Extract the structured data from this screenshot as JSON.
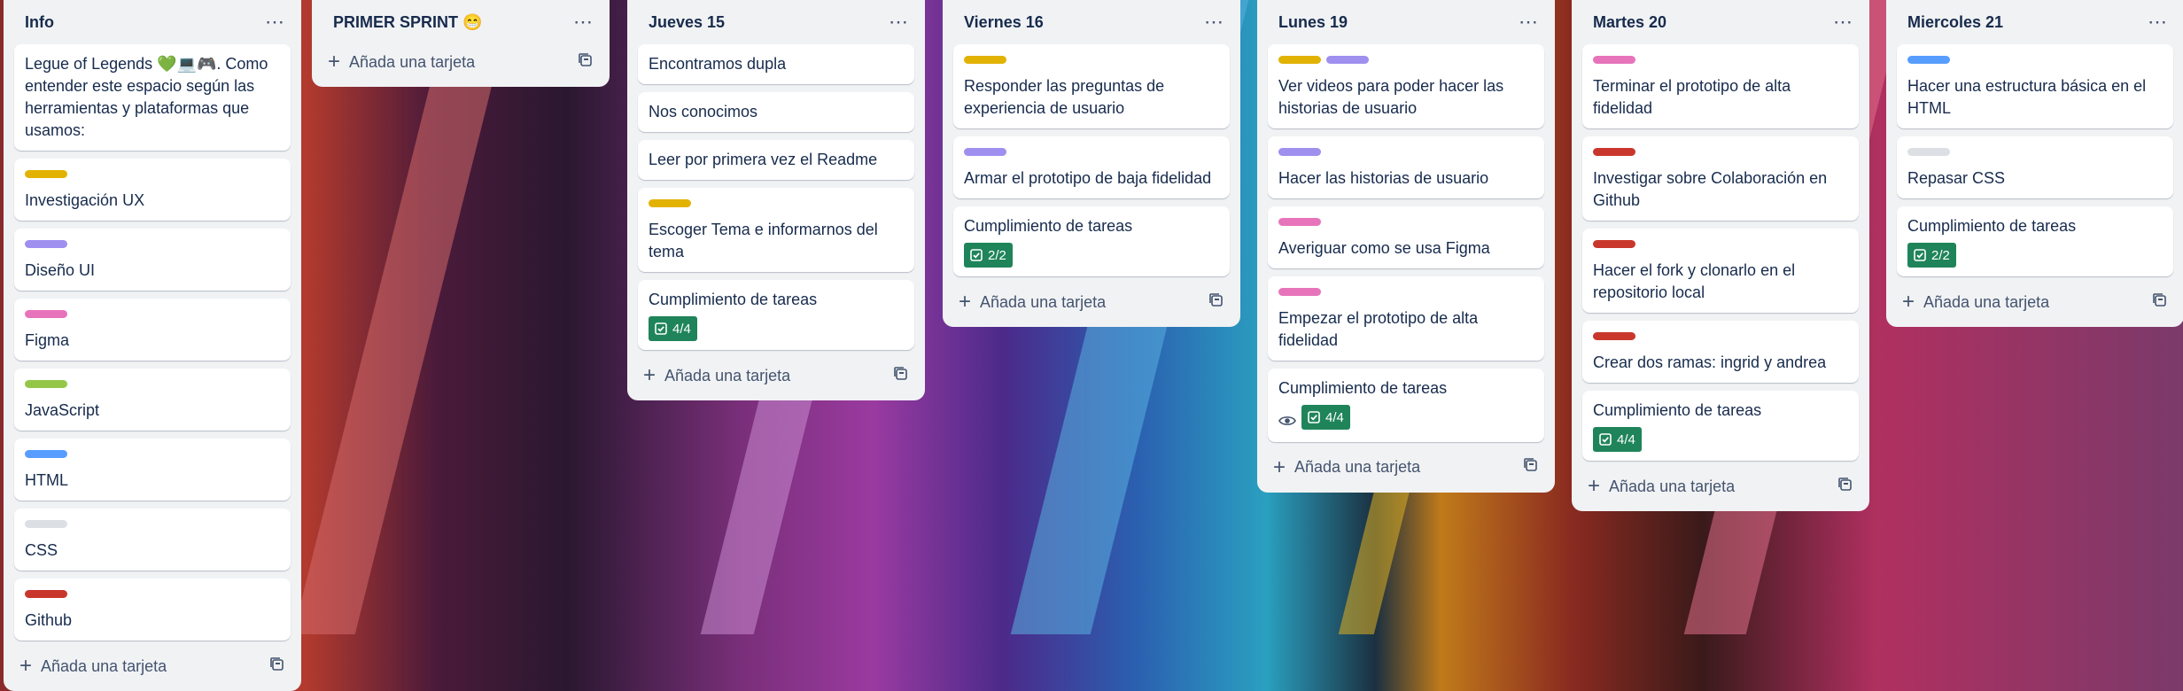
{
  "colors": {
    "yellow": "#e2b203",
    "purple": "#9f8fef",
    "pink": "#e774bb",
    "green": "#94c748",
    "blue": "#579dff",
    "gray": "#dcdfe4",
    "red": "#c9372c",
    "badge_green": "#1f845a"
  },
  "add_card_label": "Añada una tarjeta",
  "lists": [
    {
      "title": "Info",
      "cards": [
        {
          "text": "Legue of Legends 💚💻🎮. Como entender este espacio según las herramientas y plataformas que usamos:"
        },
        {
          "label": "yellow",
          "text": "Investigación UX"
        },
        {
          "label": "purple",
          "text": "Diseño UI"
        },
        {
          "label": "pink",
          "text": "Figma"
        },
        {
          "label": "green",
          "text": "JavaScript"
        },
        {
          "label": "blue",
          "text": "HTML"
        },
        {
          "label": "gray",
          "text": "CSS"
        },
        {
          "label": "red",
          "text": "Github"
        }
      ]
    },
    {
      "title": "PRIMER SPRINT 😁",
      "cards": []
    },
    {
      "title": "Jueves 15",
      "cards": [
        {
          "text": "Encontramos dupla"
        },
        {
          "text": "Nos conocimos"
        },
        {
          "text": "Leer por primera vez el Readme"
        },
        {
          "label": "yellow",
          "text": "Escoger Tema e informarnos del tema"
        },
        {
          "text": "Cumplimiento de tareas",
          "badge": "4/4"
        }
      ]
    },
    {
      "title": "Viernes 16",
      "cards": [
        {
          "label": "yellow",
          "text": "Responder las preguntas de experiencia de usuario"
        },
        {
          "label": "purple",
          "text": "Armar el prototipo de baja fidelidad"
        },
        {
          "text": "Cumplimiento de tareas",
          "badge": "2/2"
        }
      ]
    },
    {
      "title": "Lunes 19",
      "cards": [
        {
          "label": "yellow",
          "label2": "purple",
          "text": "Ver videos para poder hacer las historias de usuario"
        },
        {
          "label": "purple",
          "text": "Hacer las historias de usuario"
        },
        {
          "label": "pink",
          "text": "Averiguar como se usa Figma"
        },
        {
          "label": "pink",
          "text": "Empezar el prototipo de alta fidelidad"
        },
        {
          "text": "Cumplimiento de tareas",
          "badge": "4/4",
          "watch": true
        }
      ]
    },
    {
      "title": "Martes 20",
      "cards": [
        {
          "label": "pink",
          "text": "Terminar el prototipo de alta fidelidad"
        },
        {
          "label": "red",
          "text": "Investigar sobre Colaboración en Github"
        },
        {
          "label": "red",
          "text": "Hacer el fork y clonarlo en el repositorio local"
        },
        {
          "label": "red",
          "text": "Crear dos ramas: ingrid y andrea"
        },
        {
          "text": "Cumplimiento de tareas",
          "badge": "4/4"
        }
      ]
    },
    {
      "title": "Miercoles 21",
      "cards": [
        {
          "label": "blue",
          "text": "Hacer una estructura básica en el HTML"
        },
        {
          "label": "gray",
          "text": "Repasar CSS"
        },
        {
          "text": "Cumplimiento de tareas",
          "badge": "2/2"
        }
      ]
    }
  ]
}
